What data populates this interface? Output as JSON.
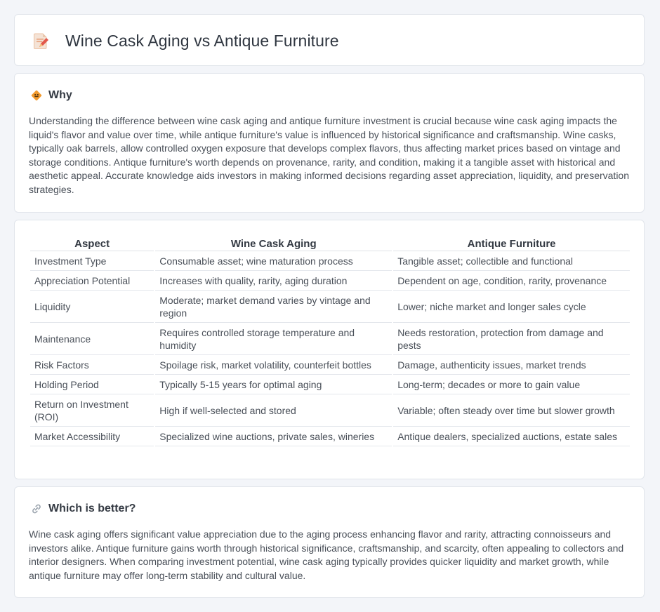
{
  "header": {
    "title": "Wine Cask Aging vs Antique Furniture",
    "icon": "document-pencil-icon"
  },
  "why": {
    "heading": "Why",
    "icon": "diamond-sign-icon",
    "text": "Understanding the difference between wine cask aging and antique furniture investment is crucial because wine cask aging impacts the liquid's flavor and value over time, while antique furniture's value is influenced by historical significance and craftsmanship. Wine casks, typically oak barrels, allow controlled oxygen exposure that develops complex flavors, thus affecting market prices based on vintage and storage conditions. Antique furniture's worth depends on provenance, rarity, and condition, making it a tangible asset with historical and aesthetic appeal. Accurate knowledge aids investors in making informed decisions regarding asset appreciation, liquidity, and preservation strategies."
  },
  "comparison": {
    "headers": [
      "Aspect",
      "Wine Cask Aging",
      "Antique Furniture"
    ],
    "rows": [
      [
        "Investment Type",
        "Consumable asset; wine maturation process",
        "Tangible asset; collectible and functional"
      ],
      [
        "Appreciation Potential",
        "Increases with quality, rarity, aging duration",
        "Dependent on age, condition, rarity, provenance"
      ],
      [
        "Liquidity",
        "Moderate; market demand varies by vintage and region",
        "Lower; niche market and longer sales cycle"
      ],
      [
        "Maintenance",
        "Requires controlled storage temperature and humidity",
        "Needs restoration, protection from damage and pests"
      ],
      [
        "Risk Factors",
        "Spoilage risk, market volatility, counterfeit bottles",
        "Damage, authenticity issues, market trends"
      ],
      [
        "Holding Period",
        "Typically 5-15 years for optimal aging",
        "Long-term; decades or more to gain value"
      ],
      [
        "Return on Investment (ROI)",
        "High if well-selected and stored",
        "Variable; often steady over time but slower growth"
      ],
      [
        "Market Accessibility",
        "Specialized wine auctions, private sales, wineries",
        "Antique dealers, specialized auctions, estate sales"
      ]
    ]
  },
  "better": {
    "heading": "Which is better?",
    "icon": "link-icon",
    "text": "Wine cask aging offers significant value appreciation due to the aging process enhancing flavor and rarity, attracting connoisseurs and investors alike. Antique furniture gains worth through historical significance, craftsmanship, and scarcity, often appealing to collectors and interior designers. When comparing investment potential, wine cask aging typically provides quicker liquidity and market growth, while antique furniture may offer long-term stability and cultural value."
  },
  "colors": {
    "background": "#f3f5f9",
    "card": "#ffffff",
    "accent_orange": "#f29a2e",
    "title_text": "#2f3640"
  }
}
